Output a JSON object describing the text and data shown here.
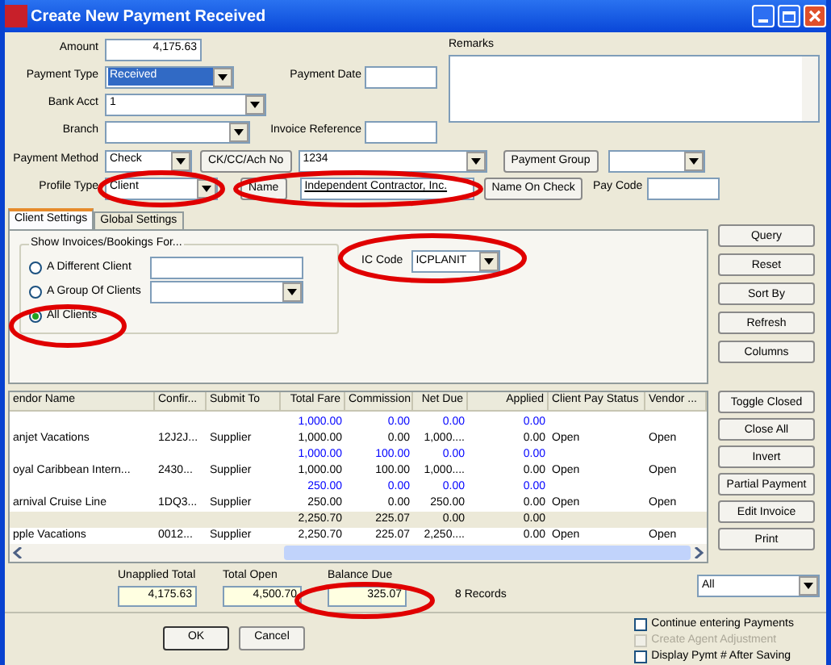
{
  "window": {
    "title": "Create New Payment Received"
  },
  "form": {
    "amount": {
      "label": "Amount",
      "value": "4,175.63"
    },
    "payment_type": {
      "label": "Payment Type",
      "value": "Received",
      "highlighted": true
    },
    "payment_date": {
      "label": "Payment Date"
    },
    "bank_acct": {
      "label": "Bank Acct",
      "value": "1"
    },
    "branch": {
      "label": "Branch"
    },
    "invoice_reference": {
      "label": "Invoice Reference"
    },
    "remarks": {
      "label": "Remarks"
    },
    "payment_method": {
      "label": "Payment Method",
      "value": "Check"
    },
    "ck_button": "CK/CC/Ach No",
    "ck_value": "1234",
    "payment_group_button": "Payment Group",
    "profile_type": {
      "label": "Profile Type",
      "value": "Client"
    },
    "name_button": "Name",
    "name_value": "Independent Contractor, Inc.",
    "name_on_check_button": "Name On Check",
    "pay_code": {
      "label": "Pay Code"
    }
  },
  "tabs": [
    {
      "label": "Client Settings",
      "selected": true
    },
    {
      "label": "Global Settings",
      "selected": false
    }
  ],
  "show_for": {
    "title": "Show Invoices/Bookings For...",
    "options": [
      {
        "label": "A Different Client",
        "selected": false,
        "kind": "text"
      },
      {
        "label": "A Group Of Clients",
        "selected": false,
        "kind": "dropdown"
      },
      {
        "label": "All Clients",
        "selected": true,
        "kind": "none"
      }
    ]
  },
  "ic_code": {
    "label": "IC Code",
    "value": "ICPLANIT"
  },
  "side_buttons": [
    "Query",
    "Reset",
    "Sort By",
    "Refresh",
    "Columns"
  ],
  "table": {
    "columns": [
      "endor Name",
      "Confir...",
      "Submit To",
      "Total Fare",
      "Commission",
      "Net Due",
      "Applied",
      "Client Pay Status",
      "Vendor ..."
    ],
    "rows": [
      {
        "kind": "allocation",
        "total_fare": "1,000.00",
        "commission": "0.00",
        "net_due": "0.00",
        "applied": "0.00"
      },
      {
        "kind": "invoice",
        "vendor": "anjet Vacations",
        "confirmation": "12J2J...",
        "submit_to": "Supplier",
        "total_fare": "1,000.00",
        "commission": "0.00",
        "net_due": "1,000....",
        "applied": "0.00",
        "client_pay_status": "Open",
        "vendor_status": "Open"
      },
      {
        "kind": "allocation",
        "total_fare": "1,000.00",
        "commission": "100.00",
        "net_due": "0.00",
        "applied": "0.00"
      },
      {
        "kind": "invoice",
        "vendor": "oyal Caribbean Intern...",
        "confirmation": "2430...",
        "submit_to": "Supplier",
        "total_fare": "1,000.00",
        "commission": "100.00",
        "net_due": "1,000....",
        "applied": "0.00",
        "client_pay_status": "Open",
        "vendor_status": "Open"
      },
      {
        "kind": "allocation",
        "total_fare": "250.00",
        "commission": "0.00",
        "net_due": "0.00",
        "applied": "0.00"
      },
      {
        "kind": "invoice",
        "vendor": "arnival Cruise Line",
        "confirmation": "1DQ3...",
        "submit_to": "Supplier",
        "total_fare": "250.00",
        "commission": "0.00",
        "net_due": "250.00",
        "applied": "0.00",
        "client_pay_status": "Open",
        "vendor_status": "Open"
      },
      {
        "kind": "subtotal",
        "total_fare": "2,250.70",
        "commission": "225.07",
        "net_due": "0.00",
        "applied": "0.00"
      },
      {
        "kind": "invoice",
        "vendor": "pple Vacations",
        "confirmation": "0012...",
        "submit_to": "Supplier",
        "total_fare": "2,250.70",
        "commission": "225.07",
        "net_due": "2,250....",
        "applied": "0.00",
        "client_pay_status": "Open",
        "vendor_status": "Open"
      }
    ]
  },
  "table_buttons": [
    "Toggle Closed",
    "Close All",
    "Invert",
    "Partial Payment",
    "Edit Invoice",
    "Print"
  ],
  "totals": [
    {
      "label": "Unapplied Total",
      "value": "4,175.63"
    },
    {
      "label": "Total Open",
      "value": "4,500.70"
    },
    {
      "label": "Balance Due",
      "value": "325.07"
    }
  ],
  "records": "8 Records",
  "filter": {
    "value": "All"
  },
  "actions": [
    "OK",
    "Cancel"
  ],
  "options": [
    {
      "label": "Continue entering Payments",
      "checked": false,
      "disabled": false
    },
    {
      "label": "Create Agent Adjustment",
      "checked": false,
      "disabled": true
    },
    {
      "label": "Display Pymt # After Saving",
      "checked": false,
      "disabled": false
    }
  ]
}
